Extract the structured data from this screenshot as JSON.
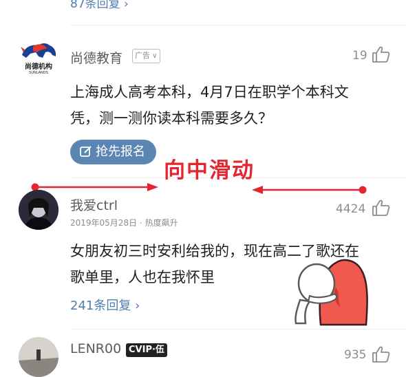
{
  "top_reply_link": "87条回复 ›",
  "ad_post": {
    "logo_text": "尚德机构",
    "logo_sub": "SUNLANDS",
    "author": "尚德教育",
    "badge": "广告",
    "likes": "19",
    "text_line1": "上海成人高考本科，4月7日在职学个本科文",
    "text_line2": "凭，测一测你读本科需要多久？",
    "cta_label": "抢先报名"
  },
  "annotation": {
    "label": "向中滑动",
    "color": "#e5252f"
  },
  "comment": {
    "author": "我爱ctrl",
    "date": "2019年05月28日",
    "meta_sep": "·",
    "meta_tag": "热度飙升",
    "likes": "4424",
    "text_line1": "女朋友初三时安利给我的，现在高二了歌还在",
    "text_line2": "歌单里，人也在我怀里",
    "reply_link": "241条回复 ›"
  },
  "next_comment": {
    "author": "LENR00",
    "vip_badge": "CVIP·伍",
    "likes": "935"
  }
}
